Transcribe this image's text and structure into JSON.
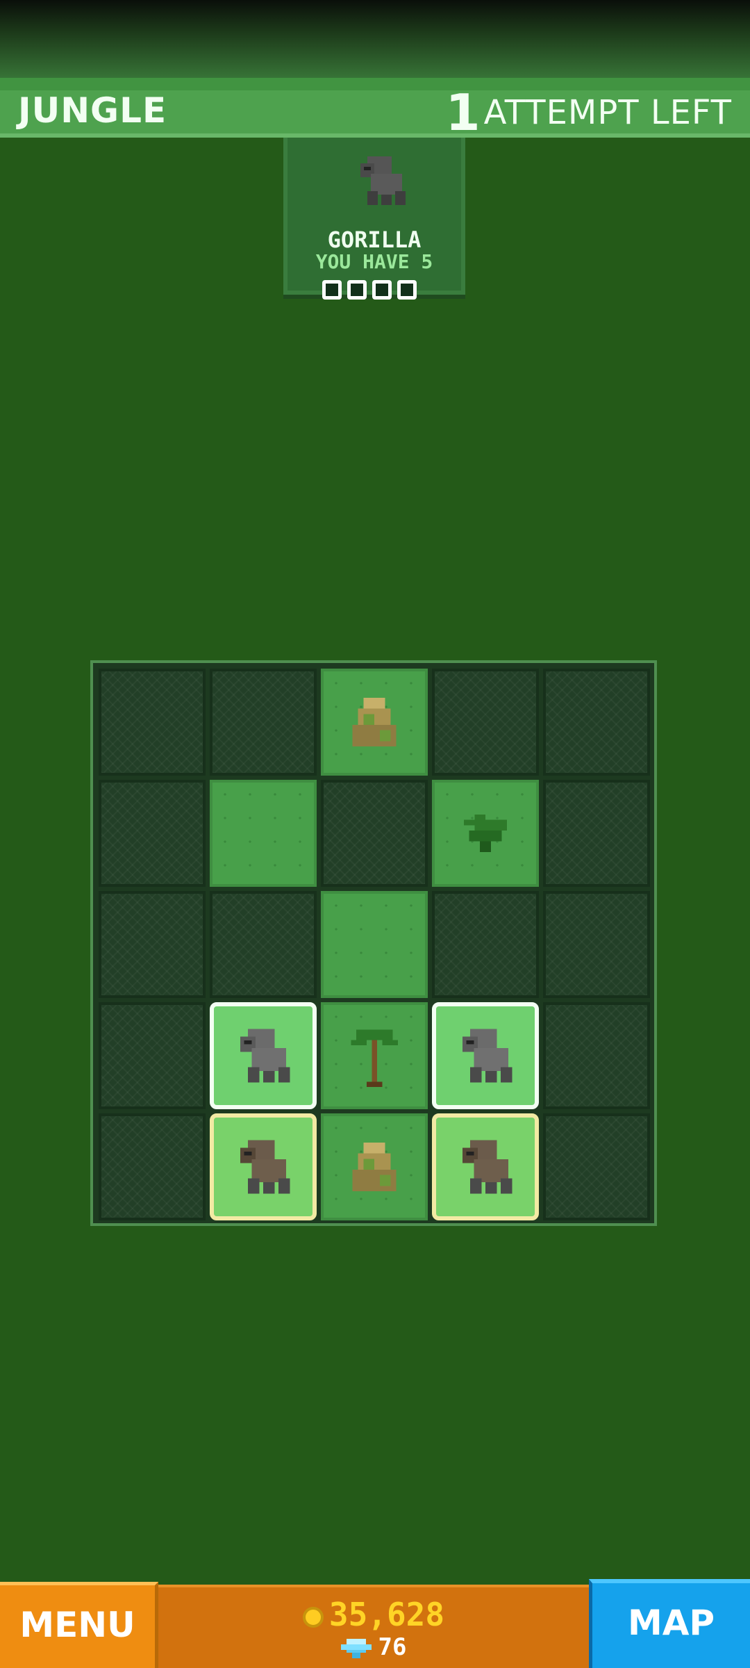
{
  "header": {
    "level_name": "JUNGLE",
    "attempts_number": "1",
    "attempts_label": "ATTEMPT LEFT"
  },
  "animal_card": {
    "animal_name": "GORILLA",
    "owned_label": "YOU HAVE 5",
    "progress_slots_filled": 0,
    "progress_slots_total": 4,
    "icon": "gorilla-icon"
  },
  "board": {
    "rows": 5,
    "cols": 5,
    "cells": [
      [
        "empty",
        "empty",
        "grass-rock",
        "empty",
        "empty"
      ],
      [
        "empty",
        "grass",
        "empty",
        "grass-fern",
        "empty"
      ],
      [
        "empty",
        "empty",
        "grass",
        "empty",
        "empty"
      ],
      [
        "empty",
        "gorilla-white",
        "grass-palm",
        "gorilla-white",
        "empty"
      ],
      [
        "empty",
        "gorilla-gold",
        "grass-rock",
        "gorilla-gold",
        "empty"
      ]
    ]
  },
  "footer": {
    "menu_label": "MENU",
    "coins": "35,628",
    "gems": "76",
    "map_label": "MAP"
  },
  "colors": {
    "background": "#245a18",
    "header": "#4ea24e",
    "menu_button": "#ef8d11",
    "currency_bar": "#d2720e",
    "map_button": "#15a2ec"
  }
}
